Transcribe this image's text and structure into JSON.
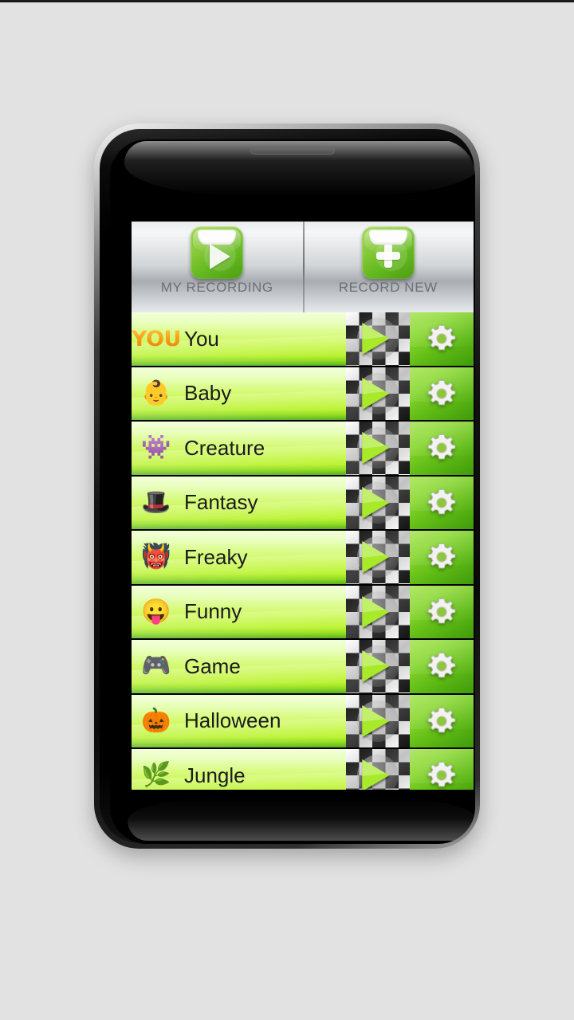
{
  "background_color": "#e2e2e2",
  "app": {
    "tabs": [
      {
        "label": "MY RECORDING",
        "icon": "folder-play-icon",
        "name": "tab-my-recording"
      },
      {
        "label": "RECORD NEW",
        "icon": "folder-plus-icon",
        "name": "tab-record-new"
      }
    ],
    "accent_green": "#b6f224",
    "accent_dark_green": "#4fae18",
    "you_badge_color": "#f7a01a",
    "rows": [
      {
        "label": "You",
        "icon": "you-text-badge",
        "icon_glyph": "YOU",
        "play": "play-icon",
        "settings": "gear-icon"
      },
      {
        "label": "Baby",
        "icon": "baby-icon",
        "icon_glyph": "👶",
        "play": "play-icon",
        "settings": "gear-icon"
      },
      {
        "label": "Creature",
        "icon": "ghost-icon",
        "icon_glyph": "👾",
        "play": "play-icon",
        "settings": "gear-icon"
      },
      {
        "label": "Fantasy",
        "icon": "wizard-hat-icon",
        "icon_glyph": "🎩",
        "play": "play-icon",
        "settings": "gear-icon"
      },
      {
        "label": "Freaky",
        "icon": "monster-icon",
        "icon_glyph": "👹",
        "play": "play-icon",
        "settings": "gear-icon"
      },
      {
        "label": "Funny",
        "icon": "tongue-face-icon",
        "icon_glyph": "😛",
        "play": "play-icon",
        "settings": "gear-icon"
      },
      {
        "label": "Game",
        "icon": "gamepad-icon",
        "icon_glyph": "🎮",
        "play": "play-icon",
        "settings": "gear-icon"
      },
      {
        "label": "Halloween",
        "icon": "pumpkin-icon",
        "icon_glyph": "🎃",
        "play": "play-icon",
        "settings": "gear-icon"
      },
      {
        "label": "Jungle",
        "icon": "leaf-icon",
        "icon_glyph": "🌿",
        "play": "play-icon",
        "settings": "gear-icon"
      }
    ]
  }
}
